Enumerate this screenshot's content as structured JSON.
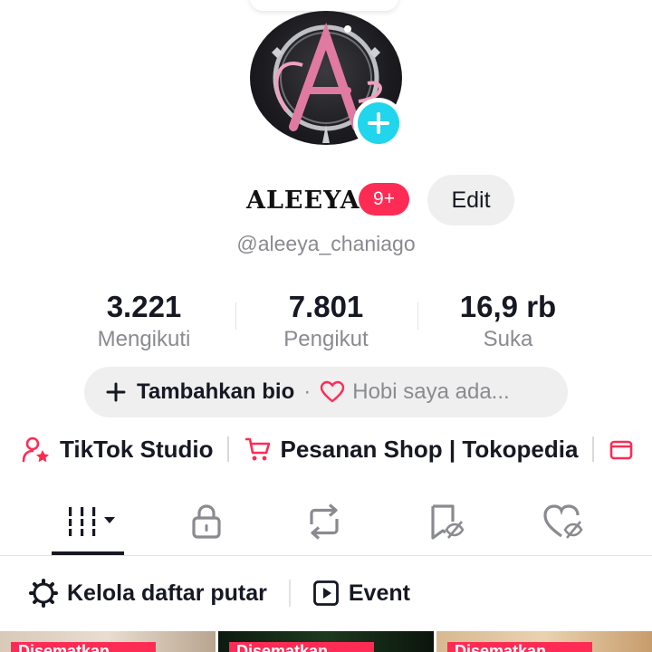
{
  "profile": {
    "name": "ALEEYA",
    "notification_badge": "9+",
    "edit_label": "Edit",
    "handle": "@aleeya_chaniago"
  },
  "stats": [
    {
      "value": "3.221",
      "label": "Mengikuti"
    },
    {
      "value": "7.801",
      "label": "Pengikut"
    },
    {
      "value": "16,9 rb",
      "label": "Suka"
    }
  ],
  "bio": {
    "add_label": "Tambahkan bio",
    "separator": "·",
    "hint": "Hobi saya ada..."
  },
  "links": [
    {
      "label": "TikTok Studio",
      "icon": "person-star-icon"
    },
    {
      "label": "Pesanan Shop | Tokopedia",
      "icon": "shopping-cart-icon"
    }
  ],
  "tabs": [
    {
      "icon": "videos-grid-icon",
      "active": true
    },
    {
      "icon": "lock-icon",
      "active": false
    },
    {
      "icon": "repost-icon",
      "active": false
    },
    {
      "icon": "bookmark-hidden-icon",
      "active": false
    },
    {
      "icon": "liked-hidden-icon",
      "active": false
    }
  ],
  "tools": [
    {
      "label": "Kelola daftar putar",
      "icon": "gear-icon"
    },
    {
      "label": "Event",
      "icon": "play-square-icon"
    }
  ],
  "thumbnails": [
    {
      "tag": "Disematkan"
    },
    {
      "tag": "Disematkan"
    },
    {
      "tag": "Disematkan"
    }
  ],
  "colors": {
    "accent": "#fe2c55",
    "add_badge": "#20d5ec",
    "muted_text": "#8a8b91",
    "pill_bg": "#efefef"
  }
}
